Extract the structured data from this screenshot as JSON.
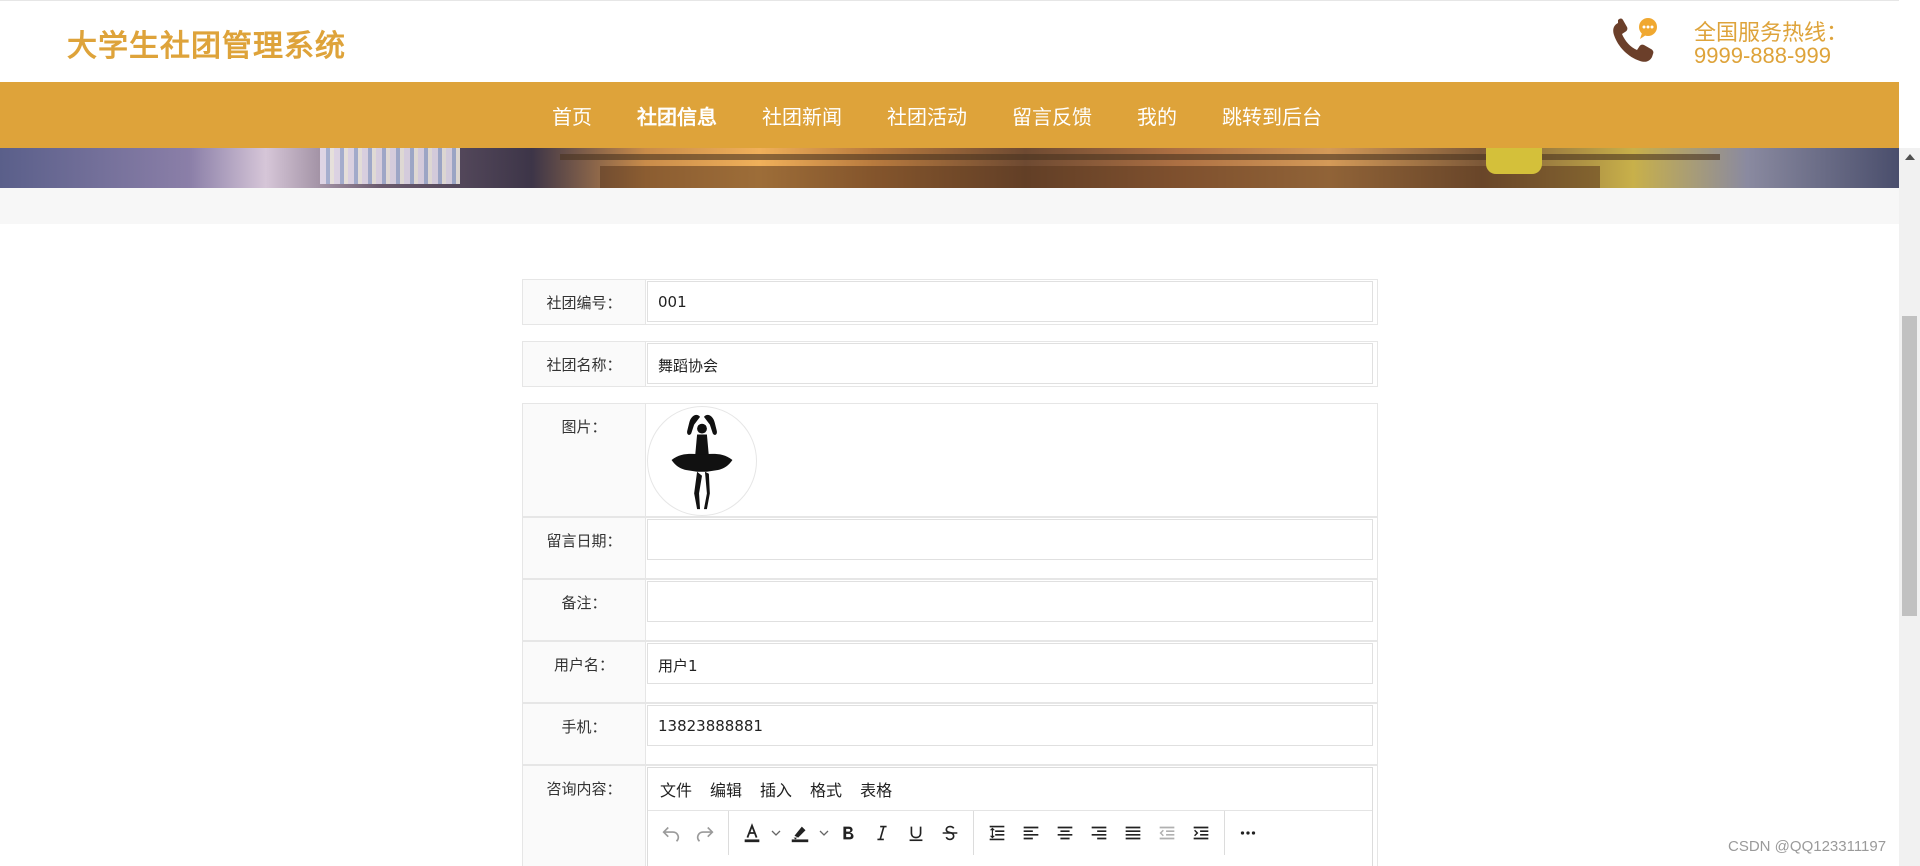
{
  "header": {
    "title": "大学生社团管理系统",
    "hotline_label": "全国服务热线：",
    "hotline_number": "9999-888-999",
    "phone_icon": "phone-chat-icon"
  },
  "nav": {
    "items": [
      "首页",
      "社团信息",
      "社团新闻",
      "社团活动",
      "留言反馈",
      "我的",
      "跳转到后台"
    ],
    "active": "社团信息"
  },
  "form": {
    "club_id": {
      "label": "社团编号：",
      "value": "001"
    },
    "club_name": {
      "label": "社团名称：",
      "value": "舞蹈协会"
    },
    "image": {
      "label": "图片：",
      "alt_icon": "ballerina-silhouette-icon"
    },
    "message_date": {
      "label": "留言日期：",
      "value": ""
    },
    "remark": {
      "label": "备注：",
      "value": ""
    },
    "username": {
      "label": "用户名：",
      "value": "用户1"
    },
    "phone": {
      "label": "手机：",
      "value": "13823888881"
    },
    "inquiry": {
      "label": "咨询内容："
    }
  },
  "editor": {
    "menu": [
      "文件",
      "编辑",
      "插入",
      "格式",
      "表格"
    ],
    "toolbar_icons": [
      "undo-icon",
      "redo-icon",
      "text-color-icon",
      "highlight-color-icon",
      "bold-icon",
      "italic-icon",
      "underline-icon",
      "strikethrough-icon",
      "line-height-icon",
      "align-left-icon",
      "align-center-icon",
      "align-right-icon",
      "align-justify-icon",
      "outdent-icon",
      "indent-icon",
      "more-icon"
    ]
  },
  "watermark": "CSDN @QQ123311197",
  "colors": {
    "brand": "#dea33a",
    "nav_text": "#ffffff"
  }
}
